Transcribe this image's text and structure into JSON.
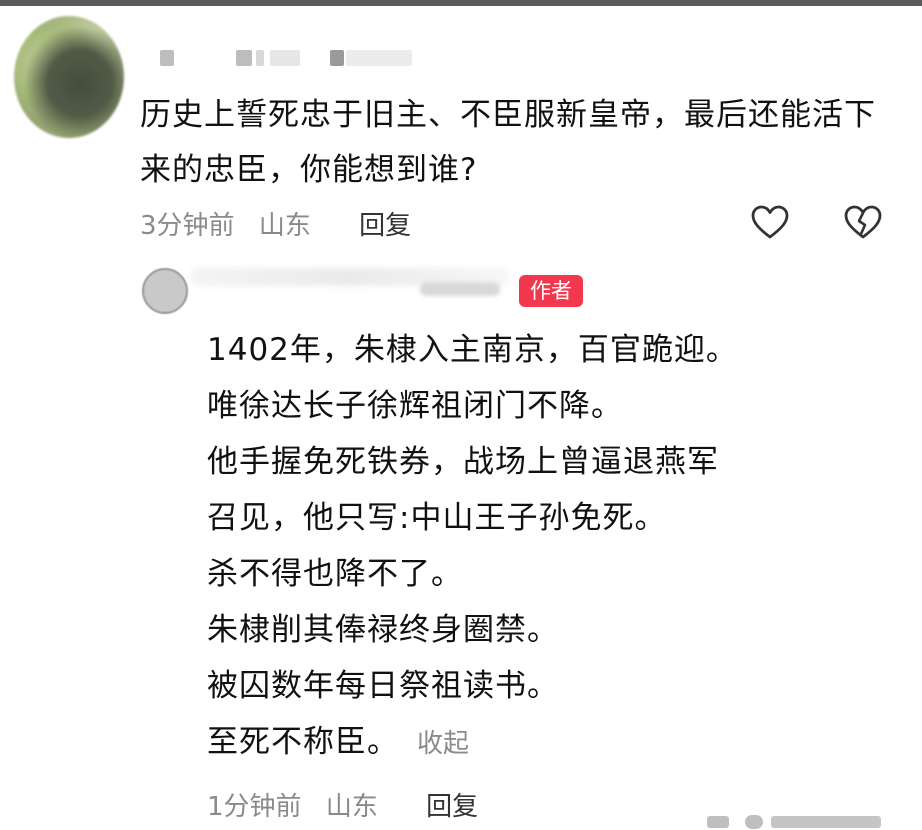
{
  "comment": {
    "text": "历史上誓死忠于旧主、不臣服新皇帝，最后还能活下来的忠臣，你能想到谁?",
    "time": "3分钟前",
    "location": "山东",
    "reply_label": "回复",
    "like_icon": "heart-outline-icon",
    "dislike_icon": "broken-heart-icon"
  },
  "reply": {
    "badge": "作者",
    "lines": [
      "1402年，朱棣入主南京，百官跪迎。",
      "唯徐达长子徐辉祖闭门不降。",
      "他手握免死铁券，战场上曾逼退燕军",
      "召见，他只写:中山王子孙免死。",
      "杀不得也降不了。",
      "朱棣削其俸禄终身圈禁。",
      "被囚数年每日祭祖读书。",
      "至死不称臣。"
    ],
    "collapse_label": "收起",
    "time": "1分钟前",
    "location": "山东",
    "reply_label": "回复"
  },
  "colors": {
    "badge": "#f1384e",
    "meta": "#8a8a8a",
    "text": "#111111"
  }
}
